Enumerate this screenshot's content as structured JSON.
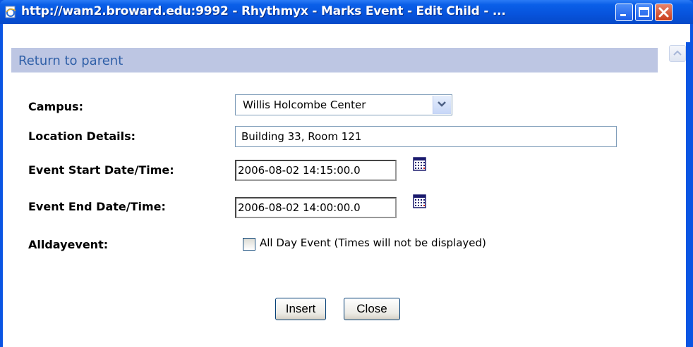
{
  "window": {
    "title": "http://wam2.broward.edu:9992 - Rhythmyx - Marks Event - Edit Child - ...",
    "title_icon": "ie-page-icon",
    "buttons": [
      "minimize",
      "maximize",
      "close"
    ]
  },
  "nav": {
    "return_link": "Return to parent"
  },
  "form": {
    "campus_label": "Campus:",
    "campus_value": "Willis Holcombe Center",
    "location_label": "Location Details:",
    "location_value": "Building 33, Room 121",
    "start_label": "Event Start Date/Time:",
    "start_value": "2006-08-02 14:15:00.0",
    "end_label": "Event End Date/Time:",
    "end_value": "2006-08-02 14:00:00.0",
    "allday_label": "Alldayevent:",
    "allday_checkbox_label": "All Day Event (Times will not be displayed)",
    "allday_checked": false
  },
  "actions": {
    "insert_label": "Insert",
    "close_label": "Close"
  },
  "colors": {
    "titlebar": "#0753dc",
    "return_bar": "#bdc6e3",
    "link": "#3060a8"
  }
}
